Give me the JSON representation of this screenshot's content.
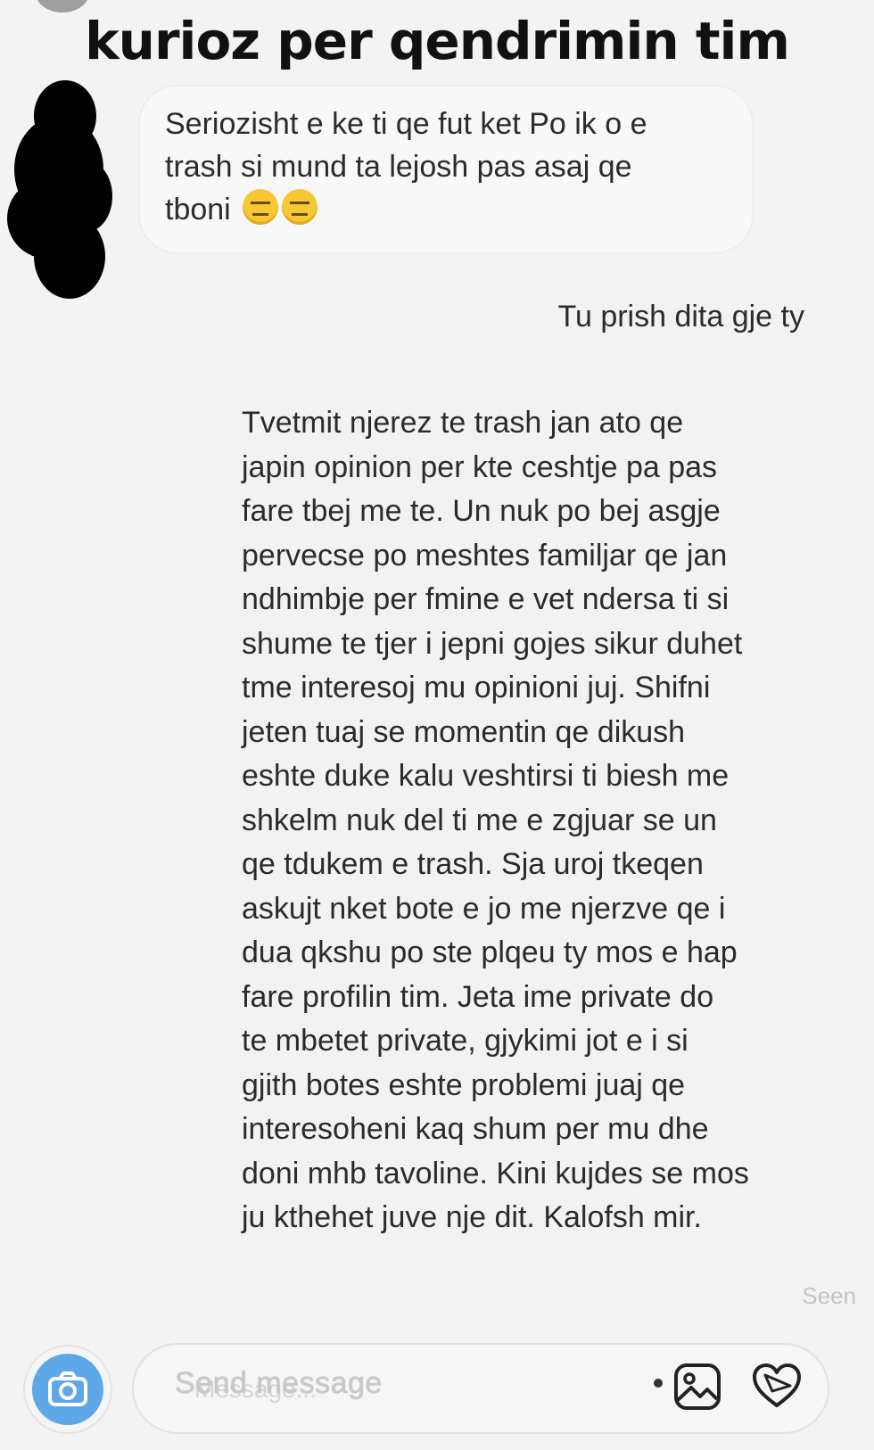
{
  "story": {
    "caption": "kurioz per qendrimin tim"
  },
  "thread": {
    "incoming_message": {
      "lines": [
        "Seriozisht e ke ti qe fut ket Po ik o e",
        "trash si mund ta lejosh pas asaj qe",
        "tboni"
      ],
      "emoji": [
        "expressionless-face-icon",
        "expressionless-face-icon"
      ]
    },
    "outgoing_short": "Tu prish dita gje ty",
    "outgoing_long_lines": [
      "Tvetmit njerez te trash jan ato qe",
      "japin opinion per kte ceshtje pa pas",
      "fare tbej me te. Un nuk po bej asgje",
      "pervecse po meshtes familjar qe jan",
      "ndhimbje per fmine e vet ndersa ti si",
      "shume te tjer i jepni gojes sikur duhet",
      "tme interesoj mu opinioni juj. Shifni",
      "jeten tuaj se momentin qe dikush",
      "eshte duke kalu veshtirsi ti biesh me",
      "shkelm nuk del ti me e zgjuar se un",
      "qe tdukem e trash. Sja uroj tkeqen",
      "askujt nket bote e jo me njerzve qe i",
      "dua qkshu po ste plqeu ty mos e hap",
      "fare profilin tim. Jeta ime private do",
      "te mbetet private, gjykimi jot e i si",
      "gjith botes eshte problemi juaj qe",
      "interesoheni kaq shum per mu dhe",
      "doni mhb tavoline. Kini kujdes se mos",
      "ju kthehet juve nje dit. Kalofsh mir."
    ],
    "seen_label": "Seen"
  },
  "composer": {
    "placeholder": "Send message",
    "ghost_label": "Message...",
    "icons": [
      "camera-icon",
      "gallery-icon",
      "heart-icon"
    ]
  },
  "colors": {
    "background": "#f3f3f3",
    "bubble": "#f2f2f2",
    "camera_blue": "#5fa8e8"
  }
}
